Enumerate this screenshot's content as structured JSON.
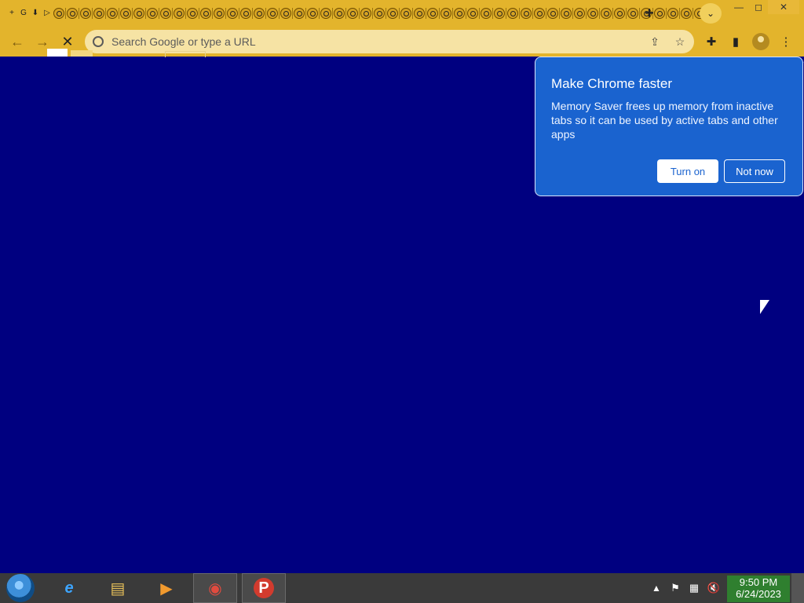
{
  "window": {
    "controls": {
      "minimize_glyph": "—",
      "maximize_glyph": "◻",
      "close_glyph": "✕"
    }
  },
  "tabs": {
    "new_tab_glyph": "+",
    "tab_search_glyph": "⌄",
    "favicons": [
      {
        "name": "plus-square-icon",
        "glyph": "+"
      },
      {
        "name": "google-g-icon",
        "glyph": "G"
      },
      {
        "name": "download-icon",
        "glyph": "⬇"
      },
      {
        "name": "play-icon",
        "glyph": "▷"
      },
      {
        "name": "tab-favicon-icon",
        "glyph": "@"
      },
      {
        "name": "tab-favicon-icon",
        "glyph": "@"
      },
      {
        "name": "tab-favicon-icon",
        "glyph": "@"
      },
      {
        "name": "tab-favicon-icon",
        "glyph": "@"
      },
      {
        "name": "tab-favicon-icon",
        "glyph": "@"
      },
      {
        "name": "tab-favicon-icon",
        "glyph": "@"
      },
      {
        "name": "tab-favicon-icon",
        "glyph": "@"
      },
      {
        "name": "tab-favicon-icon",
        "glyph": "@"
      },
      {
        "name": "tab-favicon-icon",
        "glyph": "@"
      },
      {
        "name": "tab-favicon-icon",
        "glyph": "@"
      },
      {
        "name": "tab-favicon-icon",
        "glyph": "@"
      },
      {
        "name": "tab-favicon-icon",
        "glyph": "@"
      },
      {
        "name": "tab-favicon-icon",
        "glyph": "@"
      },
      {
        "name": "tab-favicon-icon",
        "glyph": "@"
      },
      {
        "name": "tab-favicon-icon",
        "glyph": "@"
      },
      {
        "name": "tab-favicon-icon",
        "glyph": "@"
      },
      {
        "name": "tab-favicon-icon",
        "glyph": "@"
      },
      {
        "name": "tab-favicon-icon",
        "glyph": "@"
      },
      {
        "name": "tab-favicon-icon",
        "glyph": "@"
      },
      {
        "name": "tab-favicon-icon",
        "glyph": "@"
      },
      {
        "name": "tab-favicon-icon",
        "glyph": "@"
      },
      {
        "name": "tab-favicon-icon",
        "glyph": "@"
      },
      {
        "name": "tab-favicon-icon",
        "glyph": "@"
      },
      {
        "name": "tab-favicon-icon",
        "glyph": "@"
      },
      {
        "name": "tab-favicon-icon",
        "glyph": "@"
      },
      {
        "name": "tab-favicon-icon",
        "glyph": "@"
      },
      {
        "name": "tab-favicon-icon",
        "glyph": "@"
      },
      {
        "name": "tab-favicon-icon",
        "glyph": "@"
      },
      {
        "name": "tab-favicon-icon",
        "glyph": "@"
      },
      {
        "name": "tab-favicon-icon",
        "glyph": "@"
      },
      {
        "name": "tab-favicon-icon",
        "glyph": "@"
      },
      {
        "name": "tab-favicon-icon",
        "glyph": "@"
      },
      {
        "name": "tab-favicon-icon",
        "glyph": "@"
      },
      {
        "name": "tab-favicon-icon",
        "glyph": "@"
      },
      {
        "name": "tab-favicon-icon",
        "glyph": "@"
      },
      {
        "name": "tab-favicon-icon",
        "glyph": "@"
      },
      {
        "name": "tab-favicon-icon",
        "glyph": "@"
      },
      {
        "name": "tab-favicon-icon",
        "glyph": "@"
      },
      {
        "name": "tab-favicon-icon",
        "glyph": "@"
      },
      {
        "name": "tab-favicon-icon",
        "glyph": "@"
      },
      {
        "name": "tab-favicon-icon",
        "glyph": "@"
      },
      {
        "name": "tab-favicon-icon",
        "glyph": "@"
      },
      {
        "name": "tab-favicon-icon",
        "glyph": "@"
      },
      {
        "name": "tab-favicon-icon",
        "glyph": "@"
      },
      {
        "name": "tab-favicon-icon",
        "glyph": "@"
      },
      {
        "name": "tab-favicon-icon",
        "glyph": "@"
      },
      {
        "name": "tab-favicon-icon",
        "glyph": "@"
      },
      {
        "name": "tab-favicon-icon",
        "glyph": "@"
      },
      {
        "name": "tab-favicon-icon",
        "glyph": "@"
      }
    ]
  },
  "toolbar": {
    "back_glyph": "←",
    "forward_glyph": "→",
    "stop_glyph": "✕",
    "omnibox_placeholder": "Search Google or type a URL",
    "share_glyph": "⇪",
    "bookmark_glyph": "☆",
    "extensions_glyph": "✚",
    "side_panel_glyph": "▮",
    "menu_glyph": "⋮"
  },
  "popup": {
    "title": "Make Chrome faster",
    "body": "Memory Saver frees up memory from inactive tabs so it can be used by active tabs and other apps",
    "primary_button": "Turn on",
    "secondary_button": "Not now"
  },
  "taskbar": {
    "apps": [
      {
        "name": "internet-explorer-icon",
        "glyph": "e"
      },
      {
        "name": "file-explorer-icon",
        "glyph": "▤"
      },
      {
        "name": "media-player-icon",
        "glyph": "▶"
      },
      {
        "name": "chrome-icon",
        "glyph": "◉"
      },
      {
        "name": "app-p-icon",
        "glyph": "P"
      }
    ],
    "tray": {
      "up_glyph": "▲",
      "flag_glyph": "⚑",
      "network_glyph": "▦",
      "volume_glyph": "🔇"
    },
    "clock": {
      "time": "9:50 PM",
      "date": "6/24/2023"
    }
  },
  "colors": {
    "page_background": "#000080",
    "browser_theme": "#e3b42c",
    "popup_background": "#1a63cf"
  }
}
